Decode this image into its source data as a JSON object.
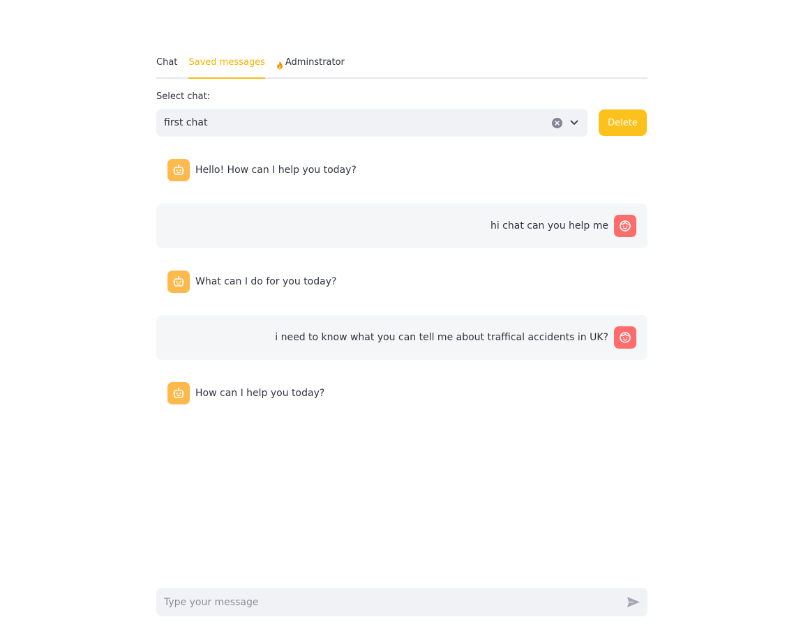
{
  "tabs": [
    {
      "label": "Chat",
      "active": false
    },
    {
      "label": "Saved messages",
      "active": true
    },
    {
      "label": "Adminstrator",
      "active": false,
      "icon": "fire-icon"
    }
  ],
  "select": {
    "label": "Select chat:",
    "value": "first chat"
  },
  "delete_button": {
    "label": "Delete"
  },
  "messages": [
    {
      "role": "assistant",
      "text": "Hello! How can I help you today?"
    },
    {
      "role": "user",
      "text": "hi chat can you help me"
    },
    {
      "role": "assistant",
      "text": "What can I do for you today?"
    },
    {
      "role": "user",
      "text": "i need to know what you can tell me about traffical accidents in UK?"
    },
    {
      "role": "assistant",
      "text": "How can I help you today?"
    }
  ],
  "chat_input": {
    "placeholder": "Type your message"
  },
  "colors": {
    "accent": "#f7bb1a",
    "delete_button": "#fcc21b",
    "bot_avatar": "#fdb94c",
    "user_avatar": "#ff6c6c",
    "input_bg": "#f0f2f6",
    "user_msg_bg": "#f5f6f8"
  }
}
